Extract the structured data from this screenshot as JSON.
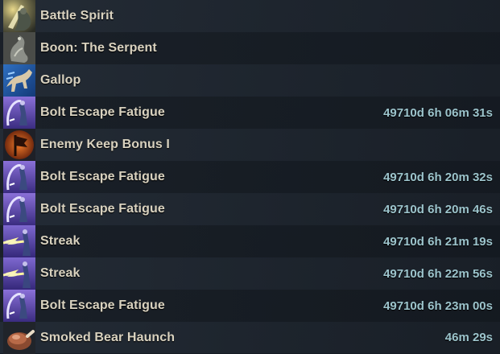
{
  "buffs": [
    {
      "name": "Battle Spirit",
      "time": "",
      "icon": "battle-spirit-icon"
    },
    {
      "name": "Boon: The Serpent",
      "time": "",
      "icon": "serpent-mundus-icon"
    },
    {
      "name": "Gallop",
      "time": "",
      "icon": "gallop-horse-icon"
    },
    {
      "name": "Bolt Escape Fatigue",
      "time": "49710d 6h 06m 31s",
      "icon": "bolt-escape-fatigue-icon"
    },
    {
      "name": "Enemy Keep Bonus I",
      "time": "",
      "icon": "keep-bonus-flag-icon"
    },
    {
      "name": "Bolt Escape Fatigue",
      "time": "49710d 6h 20m 32s",
      "icon": "bolt-escape-fatigue-icon"
    },
    {
      "name": "Bolt Escape Fatigue",
      "time": "49710d 6h 20m 46s",
      "icon": "bolt-escape-fatigue-icon"
    },
    {
      "name": "Streak",
      "time": "49710d 6h 21m 19s",
      "icon": "streak-lightning-icon"
    },
    {
      "name": "Streak",
      "time": "49710d 6h 22m 56s",
      "icon": "streak-lightning-icon"
    },
    {
      "name": "Bolt Escape Fatigue",
      "time": "49710d 6h 23m 00s",
      "icon": "bolt-escape-fatigue-icon"
    },
    {
      "name": "Smoked Bear Haunch",
      "time": "46m 29s",
      "icon": "bear-haunch-food-icon"
    }
  ],
  "colors": {
    "name_text": "#d9d2bf",
    "time_text": "#9cc4cc",
    "background": "#161c24"
  }
}
